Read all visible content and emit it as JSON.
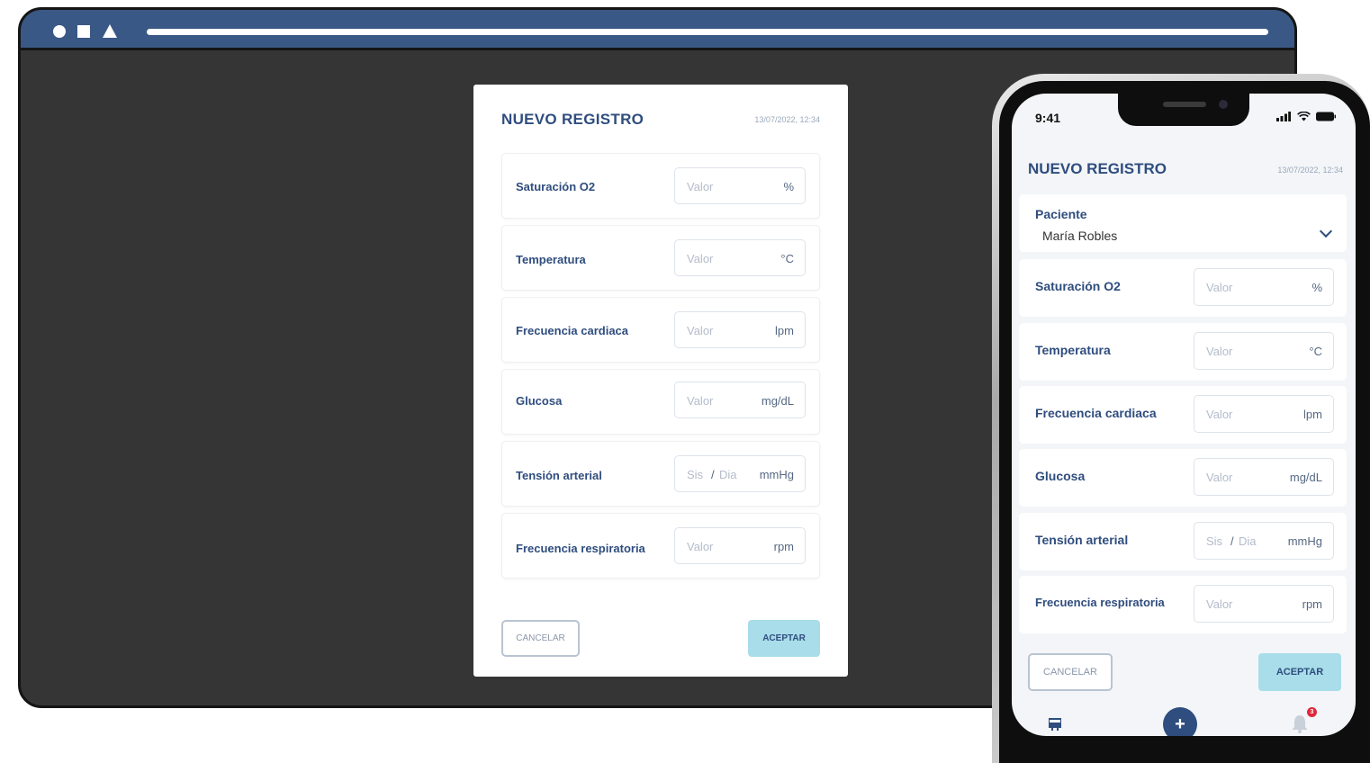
{
  "desktop": {
    "title": "NUEVO REGISTRO",
    "date": "13/07/2022, 12:34",
    "fields": [
      {
        "label": "Saturación O2",
        "placeholder": "Valor",
        "unit": "%"
      },
      {
        "label": "Temperatura",
        "placeholder": "Valor",
        "unit": "°C"
      },
      {
        "label": "Frecuencia cardiaca",
        "placeholder": "Valor",
        "unit": "lpm"
      },
      {
        "label": "Glucosa",
        "placeholder": "Valor",
        "unit": "mg/dL"
      },
      {
        "label": "Tensión arterial",
        "placeholder": "Sis",
        "slash": "/",
        "placeholder2": "Dia",
        "unit": "mmHg"
      },
      {
        "label": "Frecuencia respiratoria",
        "placeholder": "Valor",
        "unit": "rpm"
      }
    ],
    "cancel_label": "CANCELAR",
    "accept_label": "ACEPTAR"
  },
  "phone": {
    "status_time": "9:41",
    "title": "NUEVO REGISTRO",
    "date": "13/07/2022, 12:34",
    "patient_label": "Paciente",
    "patient_value": "María Robles",
    "fields": [
      {
        "label": "Saturación O2",
        "placeholder": "Valor",
        "unit": "%"
      },
      {
        "label": "Temperatura",
        "placeholder": "Valor",
        "unit": "°C"
      },
      {
        "label": "Frecuencia cardiaca",
        "placeholder": "Valor",
        "unit": "lpm"
      },
      {
        "label": "Glucosa",
        "placeholder": "Valor",
        "unit": "mg/dL"
      },
      {
        "label": "Tensión arterial",
        "placeholder": "Sis",
        "slash": "/",
        "placeholder2": "Dia",
        "unit": "mmHg"
      },
      {
        "label": "Frecuencia respiratoria",
        "placeholder": "Valor",
        "unit": "rpm"
      }
    ],
    "cancel_label": "CANCELAR",
    "accept_label": "ACEPTAR",
    "nav_add_symbol": "+",
    "notification_count": "3"
  },
  "icons": {
    "window_controls": [
      "circle-icon",
      "square-icon",
      "triangle-icon"
    ],
    "nav": [
      "home-icon",
      "add-icon",
      "bell-icon"
    ]
  },
  "colors": {
    "primary": "#2f4d7e",
    "accent": "#a8dde9",
    "browser_bar": "#3a5885",
    "browser_bg": "#353535",
    "badge": "#e0283d"
  }
}
